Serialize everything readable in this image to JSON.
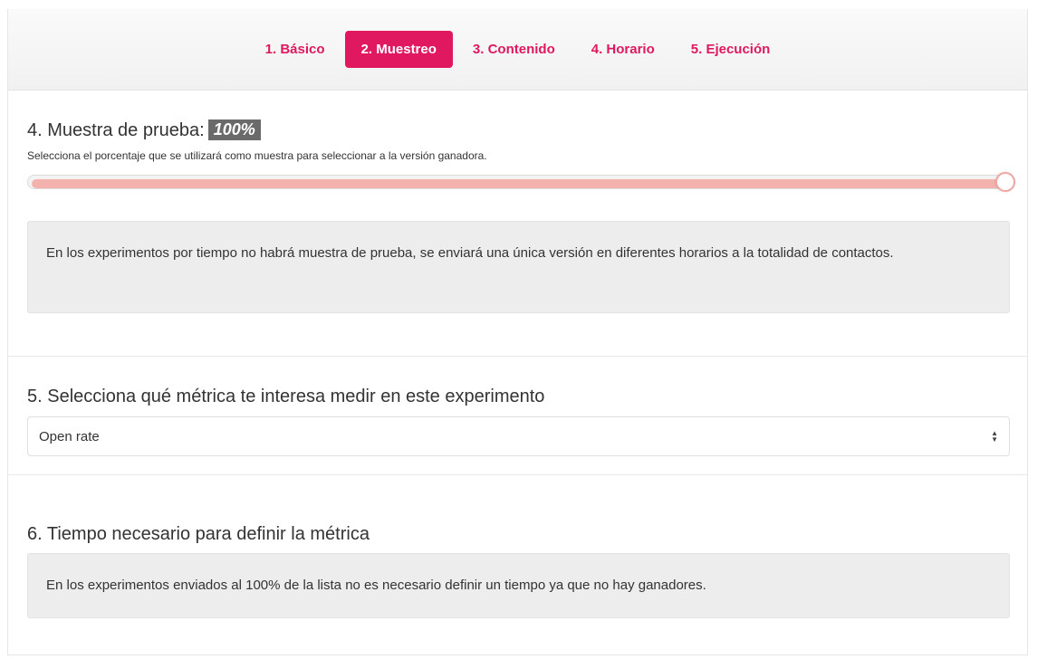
{
  "wizard": {
    "steps": [
      {
        "label": "1. Básico"
      },
      {
        "label": "2. Muestreo"
      },
      {
        "label": "3. Contenido"
      },
      {
        "label": "4. Horario"
      },
      {
        "label": "5. Ejecución"
      }
    ],
    "active_step": 1
  },
  "sample": {
    "title": "4. Muestra de prueba:",
    "value_label": "100%",
    "value": 100,
    "help": "Selecciona el porcentaje que se utilizará como muestra para seleccionar a la versión ganadora.",
    "note": "En los experimentos por tiempo no habrá muestra de prueba, se enviará una única versión en diferentes horarios a la totalidad de contactos."
  },
  "metric": {
    "title": "5. Selecciona qué métrica te interesa medir en este experimento",
    "selected": "Open rate"
  },
  "time": {
    "title": "6. Tiempo necesario para definir la métrica",
    "note": "En los experimentos enviados al 100% de la lista no es necesario definir un tiempo ya que no hay ganadores."
  },
  "colors": {
    "accent": "#e0185f",
    "slider_fill": "#f4b2ae",
    "badge": "#6a6a6a",
    "note_bg": "#ededed"
  },
  "icons": {
    "select_arrows": "sort-arrows-icon"
  }
}
